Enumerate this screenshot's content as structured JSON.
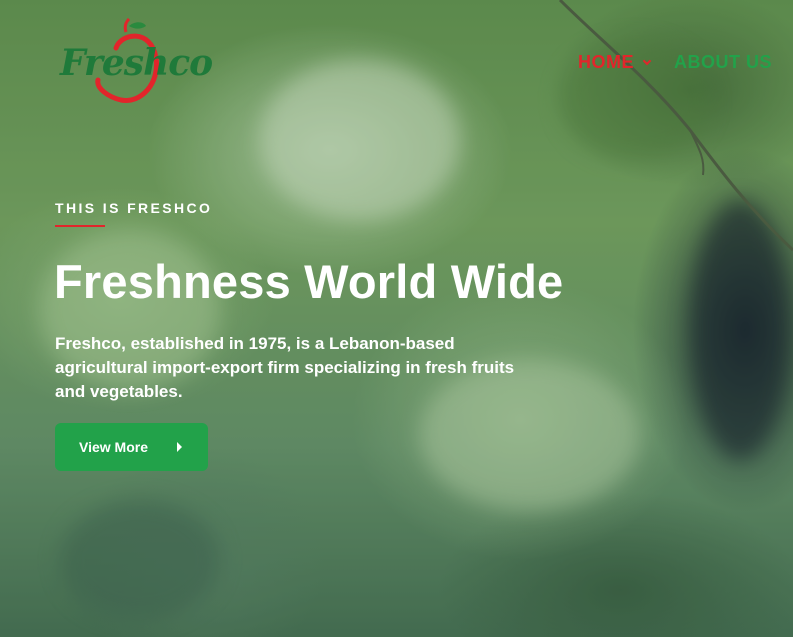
{
  "brand": {
    "logo_text": "Freshco",
    "primary_green": "#22a24a",
    "accent_red": "#e2252b"
  },
  "nav": {
    "items": [
      {
        "label": "HOME",
        "active": true,
        "has_dropdown": true
      },
      {
        "label": "ABOUT US",
        "active": false,
        "has_dropdown": false
      }
    ]
  },
  "hero": {
    "eyebrow": "THIS IS FRESHCO",
    "title": "Freshness World Wide",
    "description": "Freshco, established in 1975, is a Lebanon-based agricultural import-export firm specializing in fresh fruits and vegetables.",
    "cta_label": "View More",
    "cta_icon": "caret-right-icon"
  }
}
